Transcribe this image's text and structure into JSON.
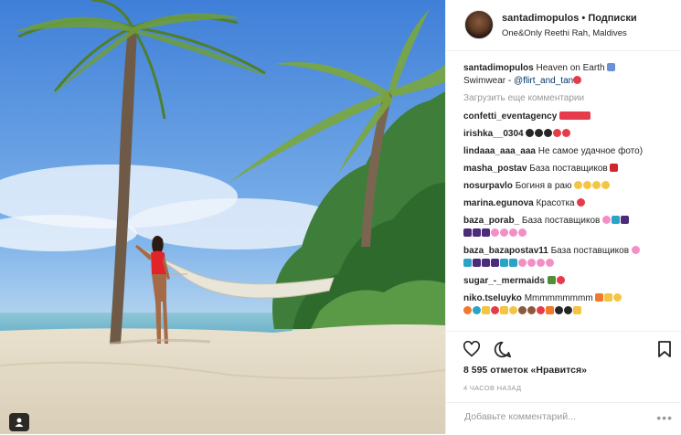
{
  "header": {
    "username": "santadimopulos",
    "separator": "•",
    "follow_label": "Подписки",
    "location": "One&Only Reethi Rah, Maldives"
  },
  "caption": {
    "username": "santadimopulos",
    "text": "Heaven on Earth",
    "line2": "Swimwear - ",
    "mention": "@flirt_and_tan"
  },
  "load_more_label": "Загрузить еще комментарии",
  "comments": [
    {
      "user": "confetti_eventagency",
      "text": ""
    },
    {
      "user": "irishka__0304",
      "text": ""
    },
    {
      "user": "lindaaa_aaa_aaa",
      "text": "Не самое удачное фото)"
    },
    {
      "user": "masha_postav",
      "text": "База поставщиков"
    },
    {
      "user": "nosurpavlo",
      "text": "Богиня в раю"
    },
    {
      "user": "marina.egunova",
      "text": "Красотка"
    },
    {
      "user": "baza_porab_",
      "text": "База поставщиков"
    },
    {
      "user": "baza_bazapostav11",
      "text": "База поставщиков"
    },
    {
      "user": "sugar_-_mermaids",
      "text": ""
    },
    {
      "user": "niko.tseluyko",
      "text": "Mmmmmmmmm"
    }
  ],
  "likes_text": "8 595 отметок «Нравится»",
  "time_text": "4 ЧАСОВ НАЗАД",
  "add_comment_placeholder": "Добавьте комментарий...",
  "more_label": "•••",
  "icons": {
    "like": "heart-icon",
    "comment": "comment-icon",
    "save": "bookmark-icon",
    "tag": "person-tag-icon"
  },
  "colors": {
    "link": "#003569",
    "muted": "#999999",
    "text": "#262626",
    "swimsuit": "#e0242a"
  }
}
